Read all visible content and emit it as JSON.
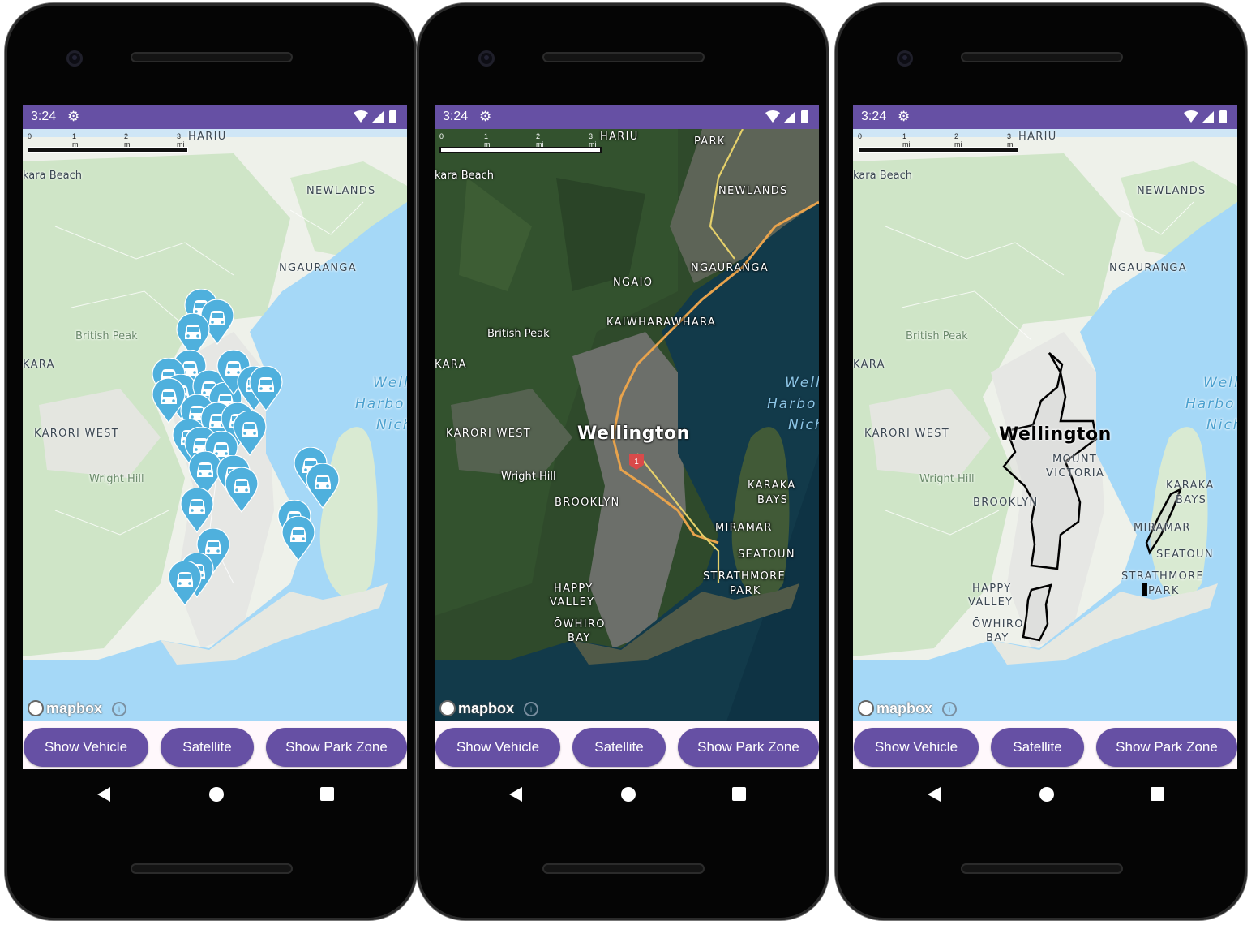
{
  "status_bar": {
    "time": "3:24"
  },
  "buttons": {
    "show_vehicle": "Show Vehicle",
    "satellite": "Satellite",
    "show_park_zone": "Show Park Zone"
  },
  "scale": {
    "t0": "0",
    "t1": "1 mi",
    "t2": "2 mi",
    "t3": "3 mi"
  },
  "attribution": {
    "logo": "mapbox",
    "info": "i"
  },
  "map_labels": {
    "hariu": "HARIU",
    "ohariu_park": "PARK",
    "makara_beach": "kara Beach",
    "newlands": "NEWLANDS",
    "ngauranga": "NGAURANGA",
    "ngaio": "NGAIO",
    "kaiwharawhara": "KAIWHARAWHARA",
    "british_peak": "British Peak",
    "kara": "KARA",
    "wellington_harbour_1": "Well",
    "wellington_harbour_2": "Harbo",
    "wellington_harbour_3": "Nich",
    "karori_west": "KARORI WEST",
    "wright_hill": "Wright Hill",
    "wellington": "Wellington",
    "mount_victoria_1": "MOUNT",
    "mount_victoria_2": "VICTORIA",
    "brooklyn": "BROOKLYN",
    "karaka_1": "KARAKA",
    "karaka_2": "BAYS",
    "miramar": "MIRAMAR",
    "seatoun": "SEATOUN",
    "strathmore_1": "STRATHMORE",
    "strathmore_2": "PARK",
    "happy_1": "HAPPY",
    "happy_2": "VALLEY",
    "owhiro_1": "ŌWHIRO",
    "owhiro_2": "BAY"
  },
  "screens": [
    {
      "map_style": "streets",
      "overlay": "vehicle-pins"
    },
    {
      "map_style": "satellite",
      "overlay": "none"
    },
    {
      "map_style": "streets",
      "overlay": "park-zones"
    }
  ],
  "colors": {
    "accent": "#6650a4",
    "pin": "#4fb0dd",
    "water": "#a5d8f7",
    "land": "#eef1ea",
    "park": "#c9e3c1"
  }
}
